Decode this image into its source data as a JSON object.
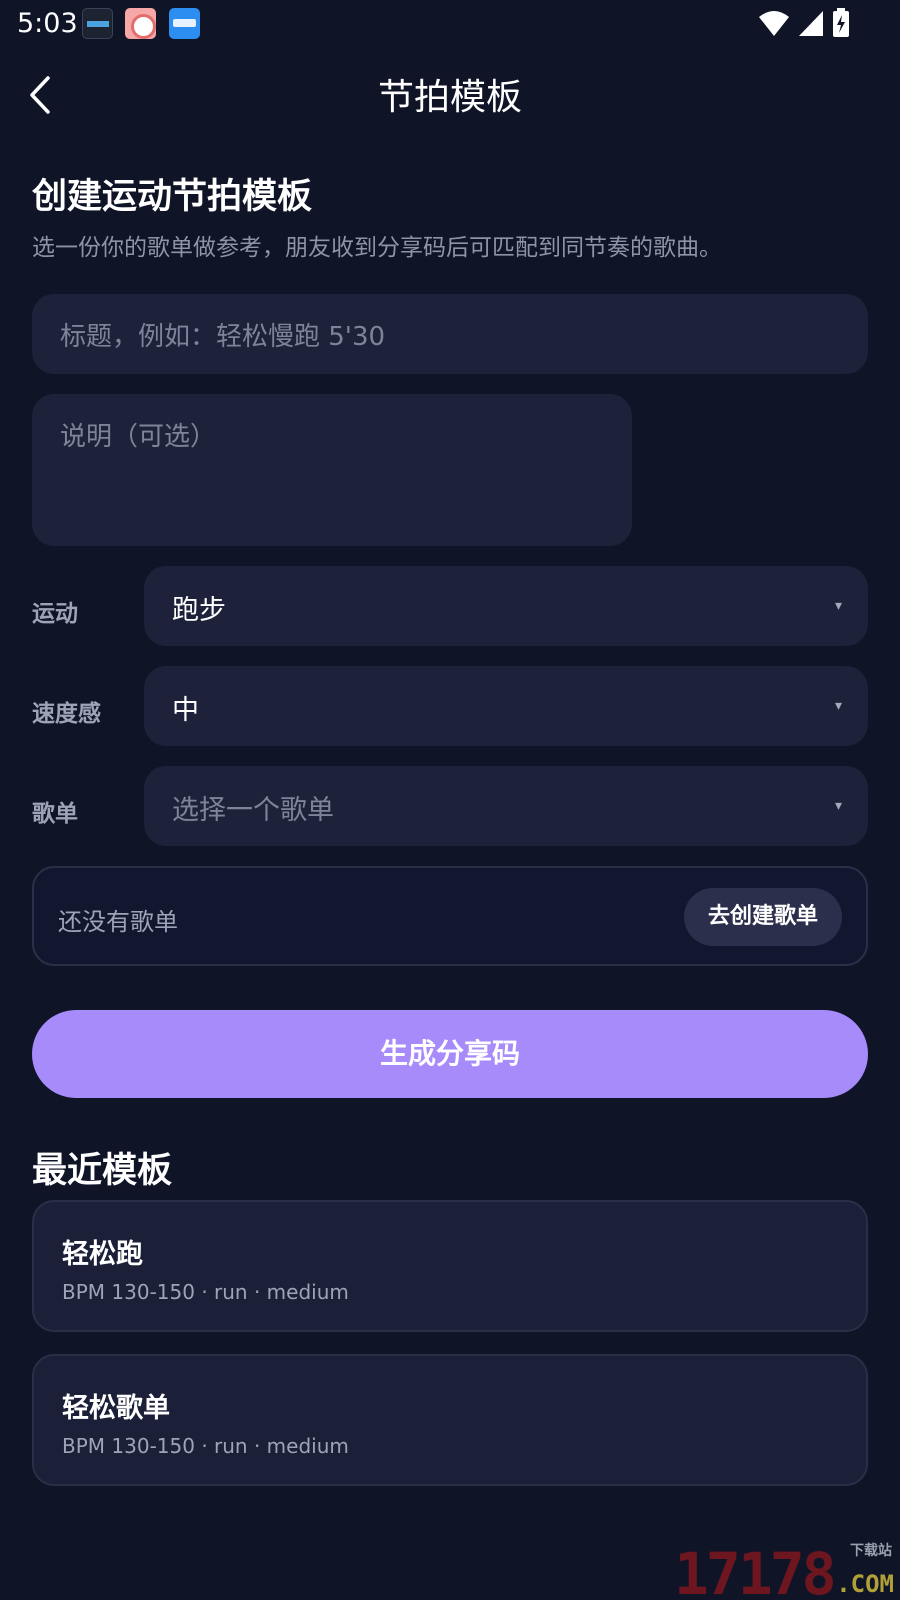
{
  "status_bar": {
    "time": "5:03",
    "notification_icons": [
      "clock-widget-icon",
      "rice-ball-app-icon",
      "blue-app-icon"
    ],
    "right_icons": [
      "wifi-icon",
      "signal-icon",
      "battery-charging-icon"
    ]
  },
  "header": {
    "title": "节拍模板",
    "back_icon": "chevron-left-icon"
  },
  "create_section": {
    "title": "创建运动节拍模板",
    "subtitle": "选一份你的歌单做参考，朋友收到分享码后可匹配到同节奏的歌曲。",
    "title_placeholder": "标题，例如：轻松慢跑 5'30",
    "description_placeholder": "说明（可选）",
    "sport_label": "运动",
    "sport_value": "跑步",
    "speed_label": "速度感",
    "speed_value": "中",
    "playlist_label": "歌单",
    "playlist_placeholder": "选择一个歌单",
    "caret": "▾",
    "empty_message": "还没有歌单",
    "create_playlist_button": "去创建歌单",
    "generate_button": "生成分享码"
  },
  "recent": {
    "title": "最近模板",
    "templates": [
      {
        "name": "轻松跑",
        "meta": "BPM 130-150 · run · medium"
      },
      {
        "name": "轻松歌单",
        "meta": "BPM 130-150 · run · medium"
      }
    ]
  },
  "watermark": {
    "number": "17178",
    "tag": "下载站",
    "suffix": ".COM"
  },
  "colors": {
    "background": "#0f1427",
    "field": "#1d2139",
    "accent": "#a78bfa",
    "muted_text": "#9ea3b8"
  }
}
